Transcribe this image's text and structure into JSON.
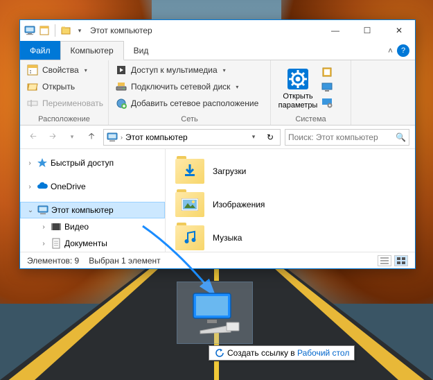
{
  "window": {
    "title": "Этот компьютер",
    "controls": {
      "min": "—",
      "max": "☐",
      "close": "✕"
    }
  },
  "tabs": {
    "file": "Файл",
    "computer": "Компьютер",
    "view": "Вид"
  },
  "ribbon": {
    "location": {
      "properties": "Свойства",
      "open": "Открыть",
      "rename": "Переименовать",
      "label": "Расположение"
    },
    "network": {
      "media": "Доступ к мультимедиа",
      "mapdrive": "Подключить сетевой диск",
      "addloc": "Добавить сетевое расположение",
      "label": "Сеть"
    },
    "system": {
      "settings": "Открыть параметры",
      "label": "Система"
    }
  },
  "address": {
    "text": "Этот компьютер",
    "search_placeholder": "Поиск: Этот компьютер"
  },
  "nav": {
    "quick": "Быстрый доступ",
    "onedrive": "OneDrive",
    "thispc": "Этот компьютер",
    "videos": "Видео",
    "documents": "Документы"
  },
  "content": {
    "downloads": "Загрузки",
    "images": "Изображения",
    "music": "Музыка"
  },
  "status": {
    "count": "Элементов: 9",
    "selected": "Выбран 1 элемент"
  },
  "tooltip": {
    "prefix": "Создать ссылку в ",
    "target": "Рабочий стол"
  }
}
